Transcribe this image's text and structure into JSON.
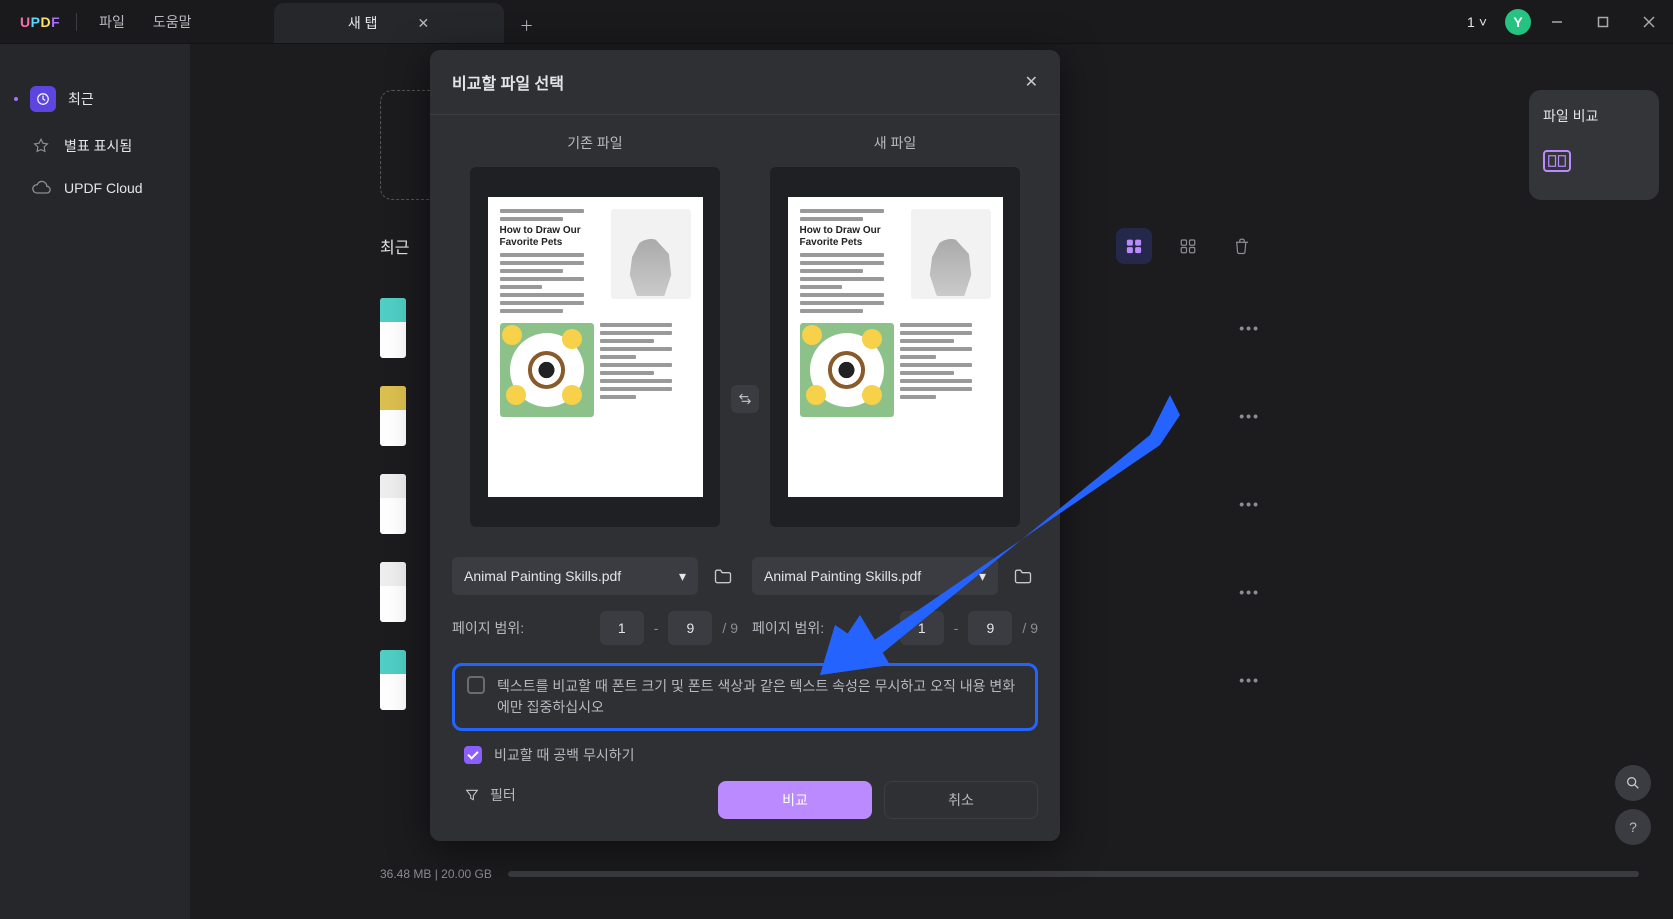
{
  "app": {
    "logo": {
      "u": "U",
      "p": "P",
      "d": "D",
      "f": "F"
    }
  },
  "menu": {
    "file": "파일",
    "help": "도움말"
  },
  "tab": {
    "label": "새 탭"
  },
  "titlebar": {
    "version": "1",
    "avatar": "Y"
  },
  "sidebar": {
    "recent": "최근",
    "starred": "별표 표시됨",
    "cloud": "UPDF Cloud"
  },
  "cards": {
    "compare": "파일 비교"
  },
  "list": {
    "title": "최근"
  },
  "status": {
    "storage": "36.48 MB | 20.00 GB"
  },
  "modal": {
    "title": "비교할 파일 선택",
    "old_label": "기존 파일",
    "new_label": "새 파일",
    "old_file": "Animal Painting Skills.pdf",
    "new_file": "Animal Painting Skills.pdf",
    "page_range_label": "페이지 범위:",
    "old_from": "1",
    "old_to": "9",
    "old_total": "/ 9",
    "new_from": "1",
    "new_to": "9",
    "new_total": "/ 9",
    "opt_ignore_attrs": "텍스트를 비교할 때 폰트 크기 및 폰트 색상과 같은 텍스트 속성은 무시하고 오직 내용 변화에만 집중하십시오",
    "opt_ignore_blanks": "비교할 때 공백 무시하기",
    "filter": "필터",
    "compare_btn": "비교",
    "cancel_btn": "취소",
    "doc_title": "How to Draw Our Favorite Pets"
  }
}
